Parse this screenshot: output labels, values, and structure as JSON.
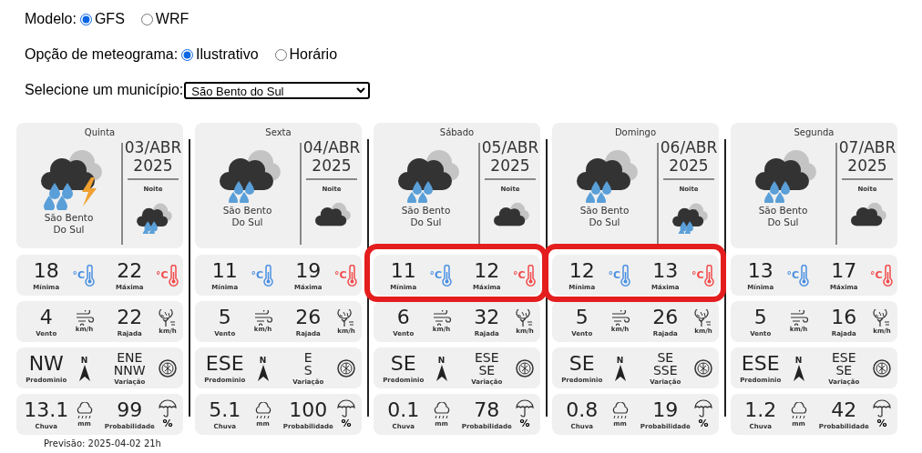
{
  "model": {
    "label": "Modelo:",
    "options": [
      {
        "label": "GFS",
        "selected": true
      },
      {
        "label": "WRF",
        "selected": false
      }
    ]
  },
  "meteogram": {
    "label": "Opção de meteograma:",
    "options": [
      {
        "label": "Ilustrativo",
        "selected": true
      },
      {
        "label": "Horário",
        "selected": false
      }
    ]
  },
  "municipality": {
    "label": "Selecione um município:",
    "value": "São Bento do Sul"
  },
  "days": [
    {
      "day": "Quinta",
      "date": "03/ABR",
      "year": "2025",
      "night_label": "Noite",
      "city": "São Bento Do Sul",
      "highlighted": false,
      "rows": [
        [
          {
            "kind": "min",
            "value": [
              "18"
            ],
            "label": "Mínima",
            "unit": "°C"
          },
          {
            "kind": "max",
            "value": [
              "22"
            ],
            "label": "Máxima",
            "unit": "°C"
          }
        ],
        [
          {
            "kind": "wind",
            "value": [
              "4"
            ],
            "label": "Vento",
            "unit": "km/h"
          },
          {
            "kind": "gust",
            "value": [
              "22"
            ],
            "label": "Rajada",
            "unit": "km/h"
          }
        ],
        [
          {
            "kind": "direction",
            "value": [
              "NW"
            ],
            "label": "Predominio",
            "unit": "N"
          },
          {
            "kind": "variation",
            "value": [
              "ENE",
              "NNW"
            ],
            "label": "Variação"
          }
        ],
        [
          {
            "kind": "rain",
            "value": [
              "13.1"
            ],
            "label": "Chuva",
            "unit": "mm"
          },
          {
            "kind": "probability",
            "value": [
              "99"
            ],
            "label": "Probabilidade",
            "unit": "%"
          }
        ]
      ]
    },
    {
      "day": "Sexta",
      "date": "04/ABR",
      "year": "2025",
      "night_label": "Noite",
      "city": "São Bento Do Sul",
      "highlighted": false,
      "rows": [
        [
          {
            "kind": "min",
            "value": [
              "11"
            ],
            "label": "Mínima",
            "unit": "°C"
          },
          {
            "kind": "max",
            "value": [
              "19"
            ],
            "label": "Máxima",
            "unit": "°C"
          }
        ],
        [
          {
            "kind": "wind",
            "value": [
              "5"
            ],
            "label": "Vento",
            "unit": "km/h"
          },
          {
            "kind": "gust",
            "value": [
              "26"
            ],
            "label": "Rajada",
            "unit": "km/h"
          }
        ],
        [
          {
            "kind": "direction",
            "value": [
              "ESE"
            ],
            "label": "Predominio",
            "unit": "N"
          },
          {
            "kind": "variation",
            "value": [
              "E",
              "S"
            ],
            "label": "Variação"
          }
        ],
        [
          {
            "kind": "rain",
            "value": [
              "5.1"
            ],
            "label": "Chuva",
            "unit": "mm"
          },
          {
            "kind": "probability",
            "value": [
              "100"
            ],
            "label": "Probabilidade",
            "unit": "%"
          }
        ]
      ]
    },
    {
      "day": "Sábado",
      "date": "05/ABR",
      "year": "2025",
      "night_label": "Noite",
      "city": "São Bento Do Sul",
      "highlighted": true,
      "rows": [
        [
          {
            "kind": "min",
            "value": [
              "11"
            ],
            "label": "Mínima",
            "unit": "°C"
          },
          {
            "kind": "max",
            "value": [
              "12"
            ],
            "label": "Máxima",
            "unit": "°C"
          }
        ],
        [
          {
            "kind": "wind",
            "value": [
              "6"
            ],
            "label": "Vento",
            "unit": "km/h"
          },
          {
            "kind": "gust",
            "value": [
              "32"
            ],
            "label": "Rajada",
            "unit": "km/h"
          }
        ],
        [
          {
            "kind": "direction",
            "value": [
              "SE"
            ],
            "label": "Predominio",
            "unit": "N"
          },
          {
            "kind": "variation",
            "value": [
              "ESE",
              "SE"
            ],
            "label": "Variação"
          }
        ],
        [
          {
            "kind": "rain",
            "value": [
              "0.1"
            ],
            "label": "Chuva",
            "unit": "mm"
          },
          {
            "kind": "probability",
            "value": [
              "78"
            ],
            "label": "Probabilidade",
            "unit": "%"
          }
        ]
      ]
    },
    {
      "day": "Domingo",
      "date": "06/ABR",
      "year": "2025",
      "night_label": "Noite",
      "city": "São Bento Do Sul",
      "highlighted": true,
      "rows": [
        [
          {
            "kind": "min",
            "value": [
              "12"
            ],
            "label": "Mínima",
            "unit": "°C"
          },
          {
            "kind": "max",
            "value": [
              "13"
            ],
            "label": "Máxima",
            "unit": "°C"
          }
        ],
        [
          {
            "kind": "wind",
            "value": [
              "5"
            ],
            "label": "Vento",
            "unit": "km/h"
          },
          {
            "kind": "gust",
            "value": [
              "26"
            ],
            "label": "Rajada",
            "unit": "km/h"
          }
        ],
        [
          {
            "kind": "direction",
            "value": [
              "SE"
            ],
            "label": "Predominio",
            "unit": "N"
          },
          {
            "kind": "variation",
            "value": [
              "SE",
              "SSE"
            ],
            "label": "Variação"
          }
        ],
        [
          {
            "kind": "rain",
            "value": [
              "0.8"
            ],
            "label": "Chuva",
            "unit": "mm"
          },
          {
            "kind": "probability",
            "value": [
              "19"
            ],
            "label": "Probabilidade",
            "unit": "%"
          }
        ]
      ]
    },
    {
      "day": "Segunda",
      "date": "07/ABR",
      "year": "2025",
      "night_label": "Noite",
      "city": "São Bento Do Sul",
      "highlighted": false,
      "rows": [
        [
          {
            "kind": "min",
            "value": [
              "13"
            ],
            "label": "Mínima",
            "unit": "°C"
          },
          {
            "kind": "max",
            "value": [
              "17"
            ],
            "label": "Máxima",
            "unit": "°C"
          }
        ],
        [
          {
            "kind": "wind",
            "value": [
              "5"
            ],
            "label": "Vento",
            "unit": "km/h"
          },
          {
            "kind": "gust",
            "value": [
              "16"
            ],
            "label": "Rajada",
            "unit": "km/h"
          }
        ],
        [
          {
            "kind": "direction",
            "value": [
              "ESE"
            ],
            "label": "Predominio",
            "unit": "N"
          },
          {
            "kind": "variation",
            "value": [
              "ESE",
              "SE"
            ],
            "label": "Variação"
          }
        ],
        [
          {
            "kind": "rain",
            "value": [
              "1.2"
            ],
            "label": "Chuva",
            "unit": "mm"
          },
          {
            "kind": "probability",
            "value": [
              "42"
            ],
            "label": "Probabilidade",
            "unit": "%"
          }
        ]
      ]
    }
  ],
  "forecast_time": "Previsão: 2025-04-02 21h"
}
